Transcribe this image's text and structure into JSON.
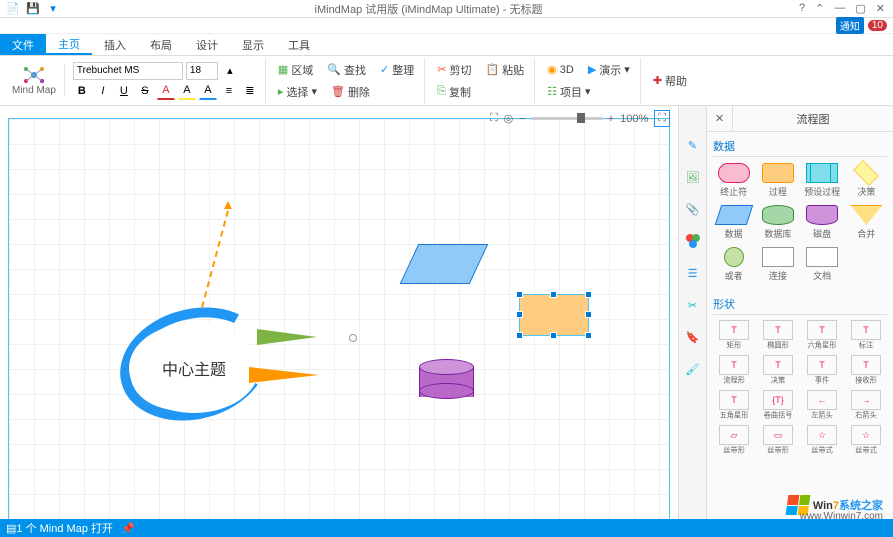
{
  "title": "iMindMap 试用版 (iMindMap Ultimate) - 无标题",
  "notify_label": "通知",
  "notify_count": "10",
  "qat": [
    "new",
    "save",
    "dropdown"
  ],
  "menu": {
    "file": "文件",
    "tabs": [
      "主页",
      "插入",
      "布局",
      "设计",
      "显示",
      "工具"
    ]
  },
  "logo_label": "Mind Map",
  "font": {
    "name": "Trebuchet MS",
    "size": "18"
  },
  "format_buttons": [
    "B",
    "I",
    "U",
    "S",
    "A",
    "A",
    "A",
    "≡",
    "≡"
  ],
  "ribbon": {
    "g1": {
      "area": "区域",
      "find": "查找",
      "tidy": "整理",
      "select": "选择",
      "delete": "删除"
    },
    "g2": {
      "cut": "剪切",
      "paste": "粘贴",
      "copy": "复制"
    },
    "g3": {
      "threed": "3D",
      "present": "演示",
      "project": "项目"
    },
    "g4": {
      "help": "帮助"
    }
  },
  "zoom": "100%",
  "central_text": "中心主题",
  "side_tools": [
    "edit",
    "image",
    "attach",
    "color",
    "list",
    "cut",
    "tag",
    "brush"
  ],
  "panel": {
    "title": "流程图",
    "sect1": "数据",
    "shapes1": [
      {
        "cls": "terminator",
        "lbl": "终止符"
      },
      {
        "cls": "process",
        "lbl": "过程"
      },
      {
        "cls": "predef",
        "lbl": "预设过程"
      },
      {
        "cls": "decision",
        "lbl": "决策"
      },
      {
        "cls": "data",
        "lbl": "数据"
      },
      {
        "cls": "database",
        "lbl": "数据库"
      },
      {
        "cls": "disk",
        "lbl": "磁盘"
      },
      {
        "cls": "merge",
        "lbl": "合并"
      },
      {
        "cls": "onpage",
        "lbl": "或者"
      },
      {
        "cls": "offpage",
        "lbl": "连接"
      },
      {
        "cls": "doc",
        "lbl": "文档"
      }
    ],
    "sect2": "形状",
    "shapes2": [
      {
        "t": "T",
        "lbl": "矩形"
      },
      {
        "t": "T",
        "lbl": "椭圆形"
      },
      {
        "t": "T",
        "lbl": "六角星形"
      },
      {
        "t": "T",
        "lbl": "标注"
      },
      {
        "t": "T",
        "lbl": "流程形"
      },
      {
        "t": "T",
        "lbl": "决策"
      },
      {
        "t": "T",
        "lbl": "事件"
      },
      {
        "t": "T",
        "lbl": "接收形"
      },
      {
        "t": "T",
        "lbl": "五角星形"
      },
      {
        "t": "{T}",
        "lbl": "卷曲括号"
      },
      {
        "t": "←",
        "lbl": "左箭头"
      },
      {
        "t": "→",
        "lbl": "右箭头"
      },
      {
        "t": "▱",
        "lbl": "丝带形"
      },
      {
        "t": "▭",
        "lbl": "丝带形"
      },
      {
        "t": "☆",
        "lbl": "丝带式"
      },
      {
        "t": "☆",
        "lbl": "丝带式"
      }
    ]
  },
  "status": "1 个 Mind Map 打开",
  "watermark": {
    "brand": "Win",
    "seven": "7",
    "rest": "系统之家",
    "url": "www.Winwin7.com"
  }
}
